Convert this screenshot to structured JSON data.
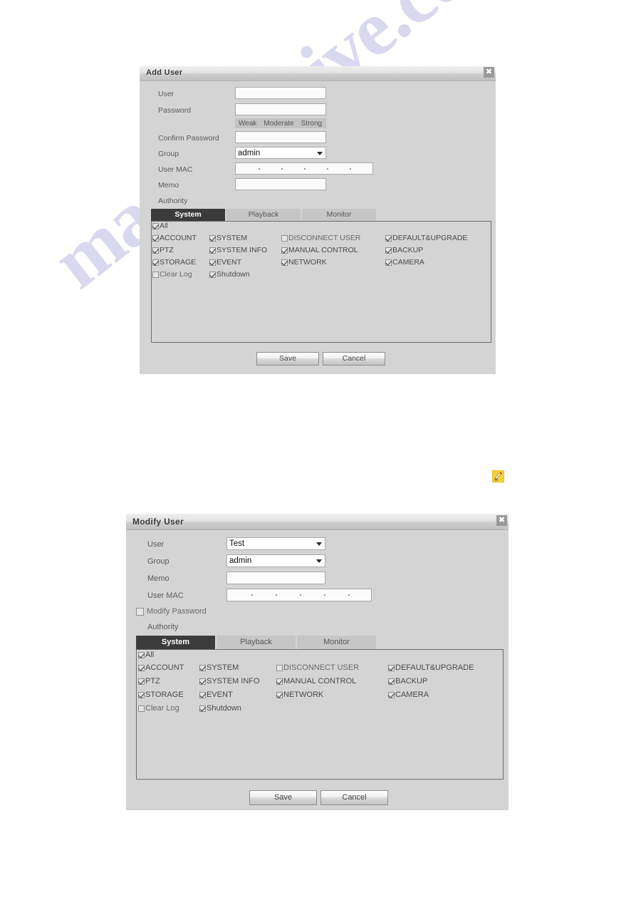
{
  "watermark": {
    "text": "manualshive.com"
  },
  "add_user_dialog": {
    "title": "Add User",
    "close_label": "✖",
    "fields": {
      "user_label": "User",
      "user_value": "",
      "password_label": "Password",
      "password_value": "",
      "confirm_password_label": "Confirm Password",
      "confirm_password_value": "",
      "group_label": "Group",
      "group_value": "admin",
      "user_mac_label": "User MAC",
      "memo_label": "Memo",
      "memo_value": "",
      "authority_label": "Authority"
    },
    "strength": {
      "weak": "Weak",
      "moderate": "Moderate",
      "strong": "Strong"
    },
    "tabs": [
      {
        "label": "System",
        "active": true
      },
      {
        "label": "Playback",
        "active": false
      },
      {
        "label": "Monitor",
        "active": false
      }
    ],
    "permissions": {
      "all": {
        "label": "All",
        "checked": true
      },
      "col1": [
        {
          "label": "ACCOUNT",
          "checked": true
        },
        {
          "label": "PTZ",
          "checked": true
        },
        {
          "label": "STORAGE",
          "checked": true
        },
        {
          "label": "Clear Log",
          "checked": false
        }
      ],
      "col2": [
        {
          "label": "SYSTEM",
          "checked": true
        },
        {
          "label": "SYSTEM INFO",
          "checked": true
        },
        {
          "label": "EVENT",
          "checked": true
        },
        {
          "label": "Shutdown",
          "checked": true
        }
      ],
      "col3": [
        {
          "label": "DISCONNECT USER",
          "checked": false
        },
        {
          "label": "MANUAL CONTROL",
          "checked": true
        },
        {
          "label": "NETWORK",
          "checked": true
        }
      ],
      "col4": [
        {
          "label": "DEFAULT&UPGRADE",
          "checked": true
        },
        {
          "label": "BACKUP",
          "checked": true
        },
        {
          "label": "CAMERA",
          "checked": true
        }
      ]
    },
    "buttons": {
      "save": "Save",
      "cancel": "Cancel"
    }
  },
  "modify_user_dialog": {
    "title": "Modify User",
    "close_label": "✖",
    "fields": {
      "user_label": "User",
      "user_value": "Test",
      "group_label": "Group",
      "group_value": "admin",
      "memo_label": "Memo",
      "memo_value": "",
      "user_mac_label": "User MAC",
      "modify_password_label": "Modify Password",
      "modify_password_checked": false,
      "authority_label": "Authority"
    },
    "tabs": [
      {
        "label": "System",
        "active": true
      },
      {
        "label": "Playback",
        "active": false
      },
      {
        "label": "Monitor",
        "active": false
      }
    ],
    "permissions": {
      "all": {
        "label": "All",
        "checked": true
      },
      "col1": [
        {
          "label": "ACCOUNT",
          "checked": true
        },
        {
          "label": "PTZ",
          "checked": true
        },
        {
          "label": "STORAGE",
          "checked": true
        },
        {
          "label": "Clear Log",
          "checked": false
        }
      ],
      "col2": [
        {
          "label": "SYSTEM",
          "checked": true
        },
        {
          "label": "SYSTEM INFO",
          "checked": true
        },
        {
          "label": "EVENT",
          "checked": true
        },
        {
          "label": "Shutdown",
          "checked": true
        }
      ],
      "col3": [
        {
          "label": "DISCONNECT USER",
          "checked": false
        },
        {
          "label": "MANUAL CONTROL",
          "checked": true
        },
        {
          "label": "NETWORK",
          "checked": true
        }
      ],
      "col4": [
        {
          "label": "DEFAULT&UPGRADE",
          "checked": true
        },
        {
          "label": "BACKUP",
          "checked": true
        },
        {
          "label": "CAMERA",
          "checked": true
        }
      ]
    },
    "buttons": {
      "save": "Save",
      "cancel": "Cancel"
    }
  },
  "edit_icon": {
    "name": "pencil-icon"
  }
}
